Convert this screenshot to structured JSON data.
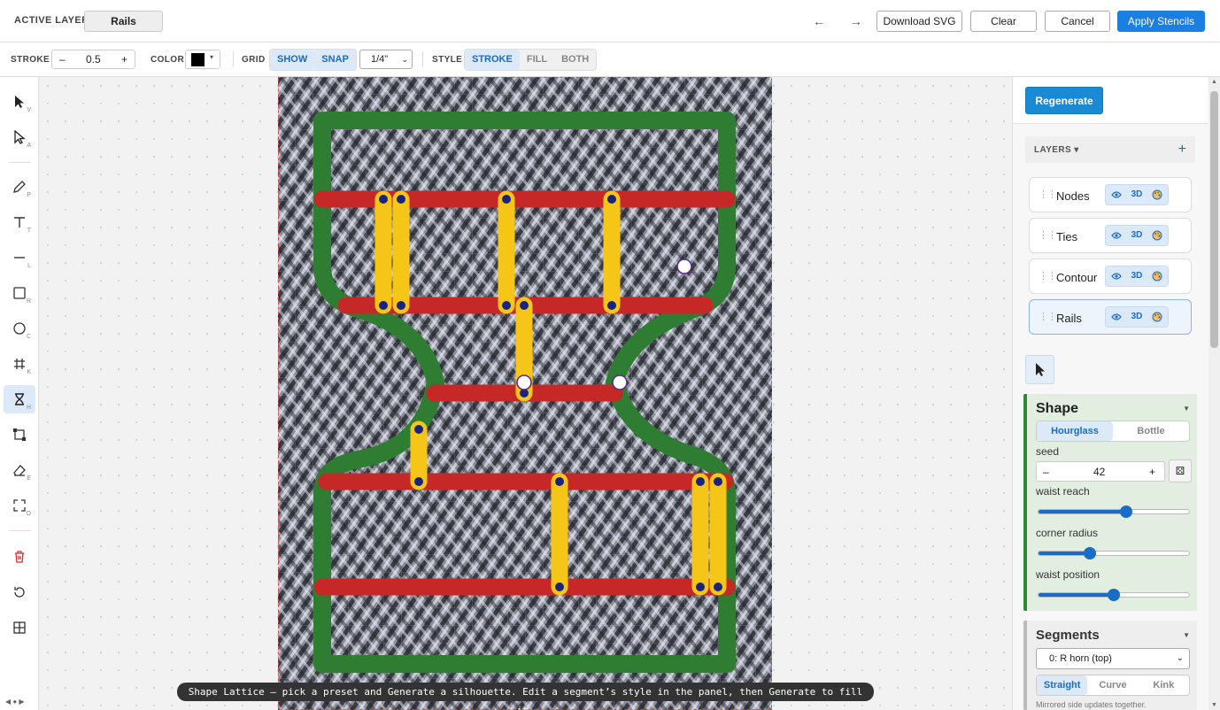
{
  "topbar": {
    "active_layer_label": "ACTIVE LAYER",
    "active_layer_value": "Rails",
    "undo_icon": "arrow-left-icon",
    "redo_icon": "arrow-right-icon",
    "download_svg": "Download SVG",
    "clear": "Clear",
    "cancel": "Cancel",
    "apply": "Apply Stencils",
    "undo_glyph": "←",
    "redo_glyph": "→"
  },
  "propbar": {
    "stroke_label": "STROKE",
    "stroke_minus": "–",
    "stroke_value": "0.5",
    "stroke_plus": "+",
    "color_label": "COLOR",
    "color_value": "#000000",
    "grid_label": "GRID",
    "grid_show": "SHOW",
    "grid_snap": "SNAP",
    "grid_size": "1/4\"",
    "style_label": "STYLE",
    "style_stroke": "STROKE",
    "style_fill": "FILL",
    "style_both": "BOTH"
  },
  "tools": {
    "select_key": "V",
    "direct_key": "A",
    "pen_key": "P",
    "text_key": "T",
    "line_key": "L",
    "rect_key": "R",
    "ellipse_key": "C",
    "grid_key": "K",
    "hourglass_key": "H",
    "frame_key": "",
    "eraser_key": "E",
    "crop_key": "O"
  },
  "canvas": {
    "caption": "Shape Lattice — pick a preset and Generate a silhouette. Edit a segment’s style in the panel, then Generate to fill it.",
    "colors": {
      "contour": "#2e7d32",
      "rails": "#c62828",
      "ties": "#f5c518",
      "nodes": "#1a237e"
    }
  },
  "panel": {
    "regenerate": "Regenerate",
    "layers_title": "LAYERS",
    "layers_caret": "▾",
    "add": "+",
    "layers": [
      {
        "name": "Nodes",
        "visibility_icon": "eye-icon",
        "mode": "3D",
        "palette_icon": "palette-icon"
      },
      {
        "name": "Ties",
        "visibility_icon": "eye-icon",
        "mode": "3D",
        "palette_icon": "palette-icon"
      },
      {
        "name": "Contour",
        "visibility_icon": "eye-icon",
        "mode": "3D",
        "palette_icon": "palette-icon"
      },
      {
        "name": "Rails",
        "visibility_icon": "eye-icon",
        "mode": "3D",
        "palette_icon": "palette-icon"
      }
    ],
    "selected_layer": "Rails",
    "shape": {
      "title": "Shape",
      "presets": [
        "Hourglass",
        "Bottle"
      ],
      "active_preset": "Hourglass",
      "seed_label": "seed",
      "seed_minus": "–",
      "seed_value": "42",
      "seed_plus": "+",
      "waist_reach_label": "waist reach",
      "waist_reach": 0.58,
      "corner_radius_label": "corner radius",
      "corner_radius": 0.34,
      "waist_position_label": "waist position",
      "waist_position": 0.5
    },
    "segments": {
      "title": "Segments",
      "selected": "0: R horn (top)",
      "styles": [
        "Straight",
        "Curve",
        "Kink"
      ],
      "active_style": "Straight",
      "note": "Mirrored side updates together."
    }
  }
}
